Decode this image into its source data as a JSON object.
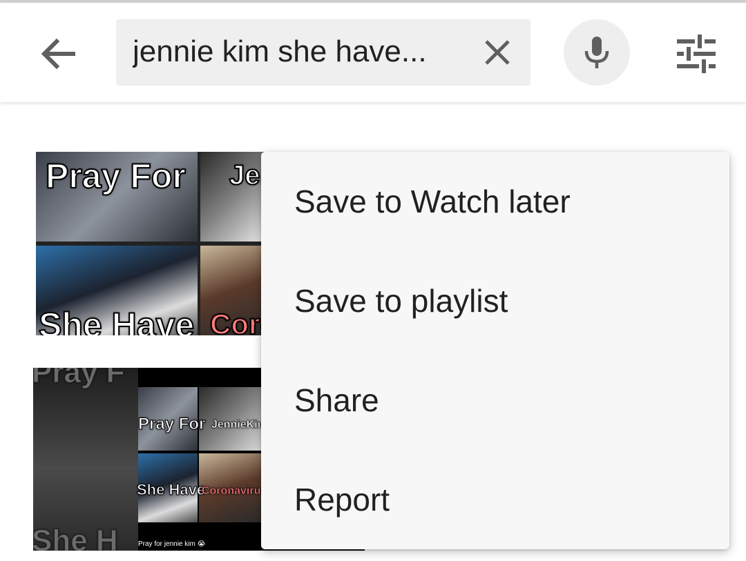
{
  "search": {
    "query": "jennie kim she have..."
  },
  "thumbnails": {
    "first": {
      "overlay_top": "Pray For",
      "overlay_top_right": "Jen",
      "overlay_bottom": "She Have",
      "overlay_bottom_right": "Coro"
    },
    "second": {
      "overlay_top_left": "Pray F",
      "overlay_pray": "Pray For",
      "overlay_name": "JennieKim",
      "overlay_bottom_left": "She Have",
      "overlay_corona": "Coronaviru",
      "overlay_bg_bottom": "She H",
      "caption": "Pray for jennie kim 😭"
    }
  },
  "menu": {
    "items": [
      {
        "label": "Save to Watch later"
      },
      {
        "label": "Save to playlist"
      },
      {
        "label": "Share"
      },
      {
        "label": "Report"
      }
    ]
  },
  "icons": {
    "back": "arrow-left-icon",
    "clear": "close-icon",
    "mic": "microphone-icon",
    "filter": "tune-sliders-icon"
  }
}
